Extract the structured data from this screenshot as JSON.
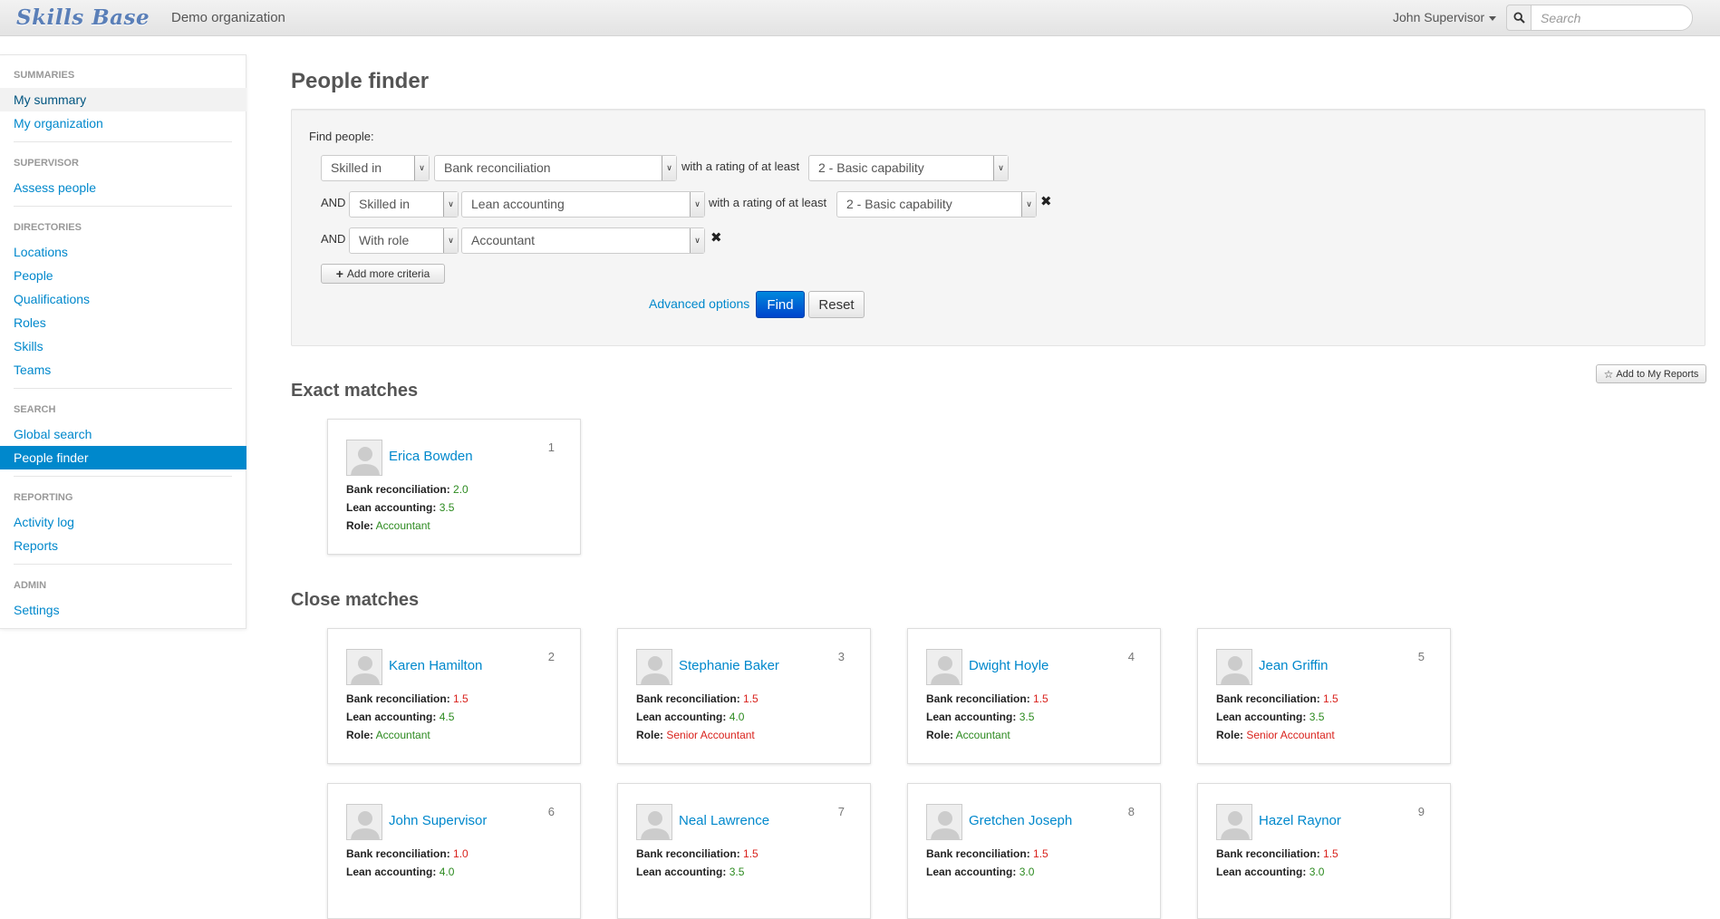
{
  "header": {
    "brand": "Skills Base",
    "org": "Demo organization",
    "user": "John Supervisor",
    "search_placeholder": "Search"
  },
  "sidebar": {
    "sections": [
      {
        "title": "SUMMARIES",
        "items": [
          "My summary",
          "My organization"
        ]
      },
      {
        "title": "SUPERVISOR",
        "items": [
          "Assess people"
        ]
      },
      {
        "title": "DIRECTORIES",
        "items": [
          "Locations",
          "People",
          "Qualifications",
          "Roles",
          "Skills",
          "Teams"
        ]
      },
      {
        "title": "SEARCH",
        "items": [
          "Global search",
          "People finder"
        ]
      },
      {
        "title": "REPORTING",
        "items": [
          "Activity log",
          "Reports"
        ]
      },
      {
        "title": "ADMIN",
        "items": [
          "Settings"
        ]
      }
    ],
    "active_item": "People finder",
    "hover_item": "My summary"
  },
  "page_title": "People finder",
  "finder": {
    "label": "Find people:",
    "criteria": [
      {
        "prefix": "",
        "type": "Skilled in",
        "value": "Bank reconciliation",
        "text": "with a rating of at least",
        "rating": "2 - Basic capability"
      },
      {
        "prefix": "AND",
        "type": "Skilled in",
        "value": "Lean accounting",
        "text": "with a rating of at least",
        "rating": "2 - Basic capability"
      },
      {
        "prefix": "AND",
        "type": "With role",
        "value": "Accountant"
      }
    ],
    "add_more": "Add more criteria",
    "advanced": "Advanced options",
    "find": "Find",
    "reset": "Reset"
  },
  "add_reports": "Add to My Reports",
  "exact_title": "Exact matches",
  "close_title": "Close matches",
  "labels": {
    "bank": "Bank reconciliation:",
    "lean": "Lean accounting:",
    "role": "Role:"
  },
  "exact": [
    {
      "rank": "1",
      "name": "Erica Bowden",
      "bank": "2.0",
      "lean": "3.5",
      "role": "Accountant"
    }
  ],
  "close": [
    {
      "rank": "2",
      "name": "Karen Hamilton",
      "bank": "1.5",
      "lean": "4.5",
      "role": "Accountant"
    },
    {
      "rank": "3",
      "name": "Stephanie Baker",
      "bank": "1.5",
      "lean": "4.0",
      "role": "Senior Accountant"
    },
    {
      "rank": "4",
      "name": "Dwight Hoyle",
      "bank": "1.5",
      "lean": "3.5",
      "role": "Accountant"
    },
    {
      "rank": "5",
      "name": "Jean Griffin",
      "bank": "1.5",
      "lean": "3.5",
      "role": "Senior Accountant"
    },
    {
      "rank": "6",
      "name": "John Supervisor",
      "bank": "1.0",
      "lean": "4.0",
      "role": ""
    },
    {
      "rank": "7",
      "name": "Neal Lawrence",
      "bank": "1.5",
      "lean": "3.5",
      "role": ""
    },
    {
      "rank": "8",
      "name": "Gretchen Joseph",
      "bank": "1.5",
      "lean": "3.0",
      "role": ""
    },
    {
      "rank": "9",
      "name": "Hazel Raynor",
      "bank": "1.5",
      "lean": "3.0",
      "role": ""
    }
  ],
  "colors": {
    "good": "#2c8a1f",
    "bad": "#d9221c",
    "link": "#0088cc",
    "active": "#0088cc"
  }
}
